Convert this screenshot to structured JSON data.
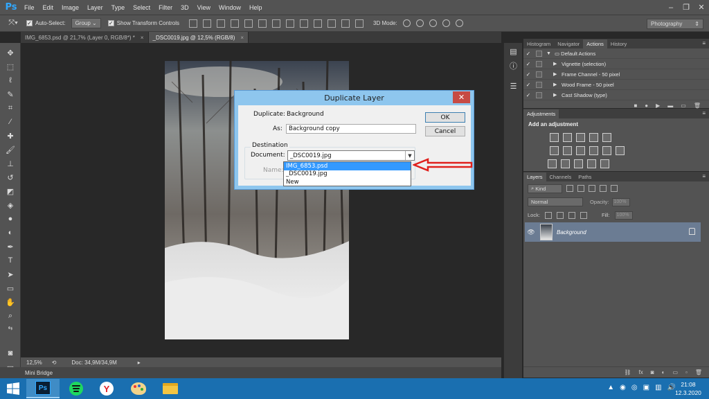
{
  "menu": [
    "File",
    "Edit",
    "Image",
    "Layer",
    "Type",
    "Select",
    "Filter",
    "3D",
    "View",
    "Window",
    "Help"
  ],
  "options": {
    "auto_select_label": "Auto-Select:",
    "auto_select_value": "Group",
    "show_transform_label": "Show Transform Controls",
    "mode3d_label": "3D Mode:",
    "workspace": "Photography"
  },
  "tabs": [
    {
      "label": "IMG_6853.psd @ 21,7% (Layer 0, RGB/8*) *"
    },
    {
      "label": "_DSC0019.jpg @ 12,5% (RGB/8)"
    }
  ],
  "status": {
    "zoom": "12,5%",
    "doc": "Doc: 34,9M/34,9M"
  },
  "mini_bridge": "Mini Bridge",
  "panels": {
    "tabs_top": [
      "Histogram",
      "Navigator",
      "Actions",
      "History"
    ],
    "actions": [
      "Default Actions",
      "Vignette (selection)",
      "Frame Channel - 50 pixel",
      "Wood Frame - 50 pixel",
      "Cast Shadow (type)"
    ],
    "adjustments_tab": "Adjustments",
    "adjustments_title": "Add an adjustment",
    "layer_tabs": [
      "Layers",
      "Channels",
      "Paths"
    ],
    "kind": "Kind",
    "blend": "Normal",
    "opacity_label": "Opacity:",
    "opacity": "100%",
    "lock_label": "Lock:",
    "fill_label": "Fill:",
    "fill": "100%",
    "layer_name": "Background"
  },
  "dialog": {
    "title": "Duplicate Layer",
    "duplicate_label": "Duplicate:",
    "duplicate_value": "Background",
    "as_label": "As:",
    "as_value": "Background copy",
    "destination_label": "Destination",
    "document_label": "Document:",
    "document_value": "_DSC0019.jpg",
    "name_label": "Name:",
    "ok": "OK",
    "cancel": "Cancel",
    "options": [
      "IMG_6853.psd",
      "_DSC0019.jpg",
      "New"
    ]
  },
  "clock": {
    "time": "21:08",
    "date": "12.3.2020"
  },
  "colors": {
    "arrow": "#e0201c",
    "taskbar": "#1a6fb0",
    "dropdown_highlight": "#3399ff"
  }
}
